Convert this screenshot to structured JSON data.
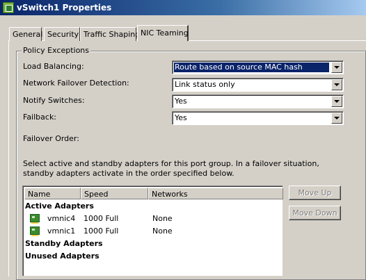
{
  "window": {
    "title": "vSwitch1 Properties"
  },
  "tabs": [
    {
      "label": "General"
    },
    {
      "label": "Security"
    },
    {
      "label": "Traffic Shaping"
    },
    {
      "label": "NIC Teaming"
    }
  ],
  "active_tab": "NIC Teaming",
  "policy_exceptions": {
    "legend": "Policy Exceptions",
    "load_balancing": {
      "label": "Load Balancing:",
      "value": "Route based on source MAC hash"
    },
    "failover_detection": {
      "label": "Network Failover Detection:",
      "value": "Link status only"
    },
    "notify_switches": {
      "label": "Notify Switches:",
      "value": "Yes"
    },
    "failback": {
      "label": "Failback:",
      "value": "Yes"
    },
    "failover_order": {
      "label": "Failover Order:"
    },
    "description": "Select active and standby adapters for this port group.  In a failover situation, standby adapters activate  in the order specified below.",
    "list": {
      "columns": [
        "Name",
        "Speed",
        "Networks"
      ],
      "groups": {
        "active": "Active Adapters",
        "standby": "Standby Adapters",
        "unused": "Unused Adapters"
      },
      "active_adapters": [
        {
          "name": "vmnic4",
          "speed": "1000 Full",
          "networks": "None",
          "icon": "nic-icon"
        },
        {
          "name": "vmnic1",
          "speed": "1000 Full",
          "networks": "None",
          "icon": "nic-icon"
        }
      ]
    },
    "buttons": {
      "move_up": "Move Up",
      "move_down": "Move Down"
    }
  }
}
